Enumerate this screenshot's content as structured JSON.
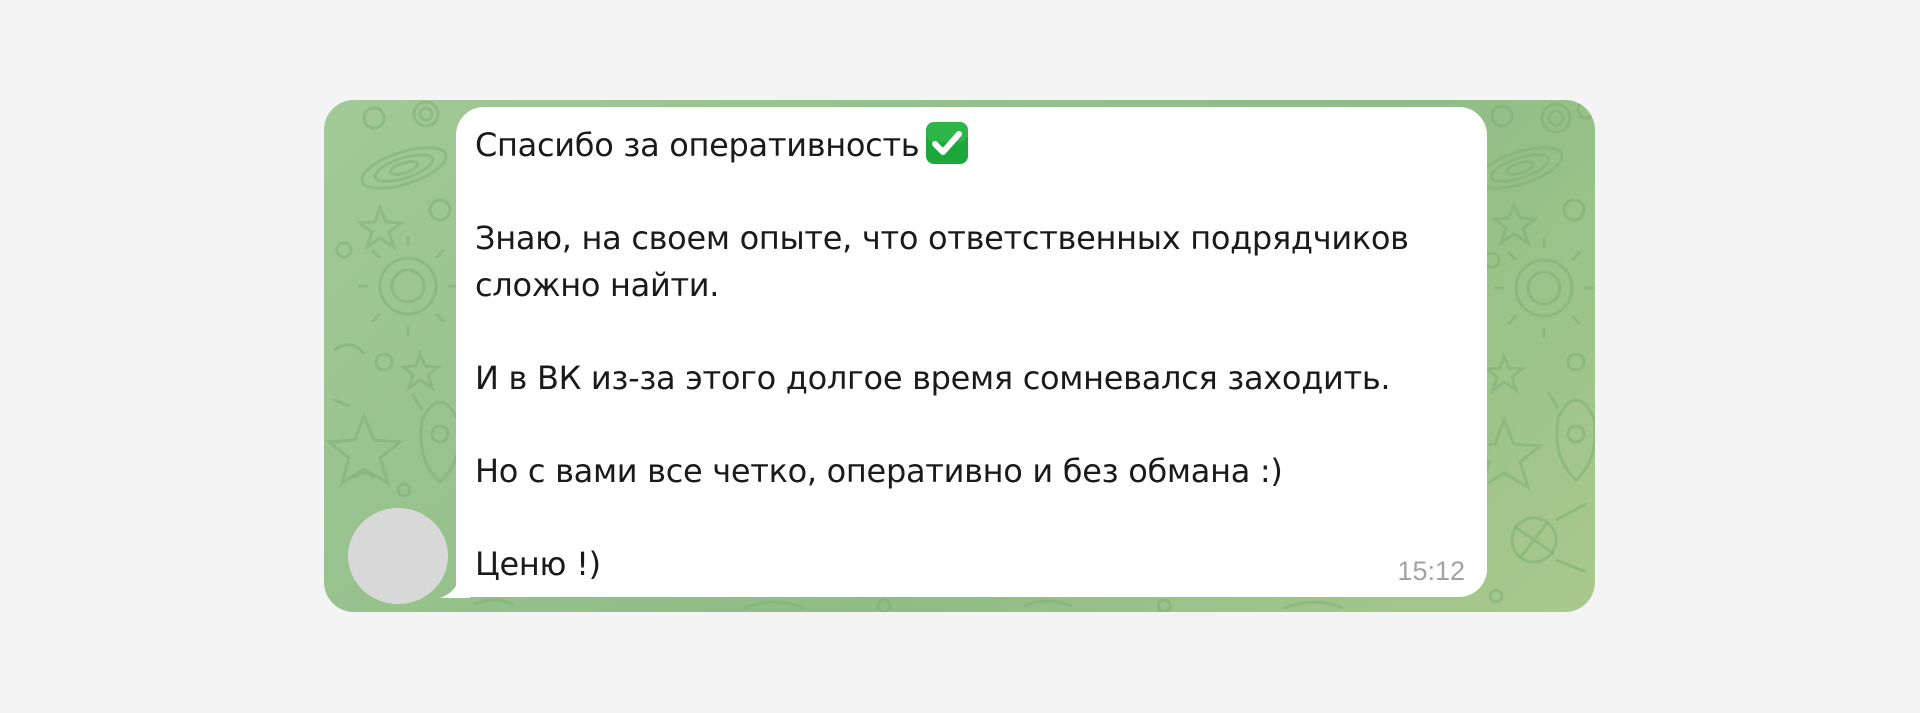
{
  "chat": {
    "wallpaper": "doodle-pattern",
    "colors": {
      "background": "#f4f4f4",
      "wallpaper": "#98c38d",
      "bubble": "#ffffff",
      "text": "#1a1a1a",
      "time": "#a3a3a3",
      "check_emoji": "#1ca73a"
    },
    "avatar": {
      "icon": "avatar-placeholder"
    },
    "message": {
      "lines": [
        "Спасибо за оперативность",
        "",
        "Знаю, на своем опыте, что ответственных подрядчиков",
        "сложно найти.",
        "",
        "И в ВК из-за этого долгое время сомневался заходить.",
        "",
        "Но с вами все четко, оперативно и без обмана :)",
        "",
        "Ценю !)"
      ],
      "emoji": "check-mark-button-icon",
      "time": "15:12"
    }
  }
}
